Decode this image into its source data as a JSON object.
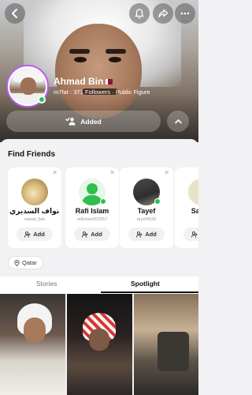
{
  "profile": {
    "name": "Ahmad Bin",
    "flag_icon": "qatar-flag",
    "username": "m7fat",
    "followers": "371 Followers",
    "category": "Public Figure",
    "meta_separator": " · ",
    "online": true,
    "ring_color": "#b95df2"
  },
  "top_bar": {
    "back_icon": "chevron-left-icon",
    "bell_icon": "bell-icon",
    "share_icon": "share-arrow-icon",
    "more_icon": "more-dots-icon"
  },
  "actions": {
    "added_label": "Added",
    "added_icon": "user-check-icon",
    "expand_icon": "chevron-up-icon"
  },
  "find_friends": {
    "title": "Find Friends",
    "add_label": "Add",
    "cards": [
      {
        "name": "نواف السديري...",
        "username": "nawaf_bsk",
        "has_photo": true
      },
      {
        "name": "Rafi Islam",
        "username": "rafiislam202957",
        "has_photo": false,
        "online": true
      },
      {
        "name": "Tayef",
        "username": "tayef4639",
        "has_photo": true,
        "online": true
      },
      {
        "name": "Sayed",
        "username": "",
        "has_photo": true
      }
    ]
  },
  "location": {
    "label": "Qatar",
    "icon": "map-pin-icon"
  },
  "tabs": [
    {
      "label": "Stories",
      "active": false
    },
    {
      "label": "Spotlight",
      "active": true
    }
  ],
  "colors": {
    "online": "#23c552",
    "accent_ring": "#b95df2",
    "sheet_bg": "#f2f2f4"
  }
}
